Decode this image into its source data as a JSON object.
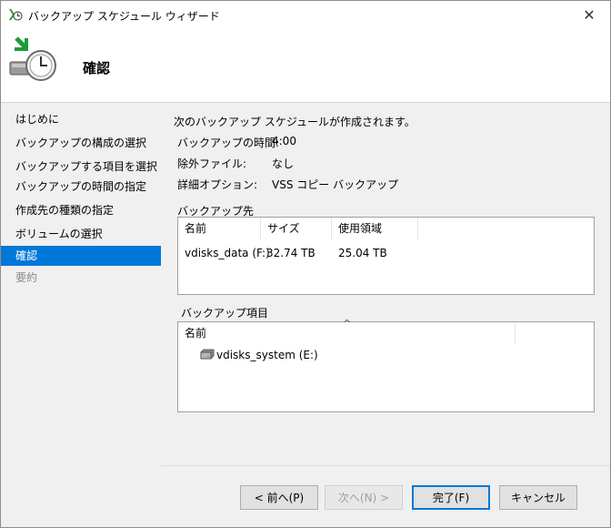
{
  "window": {
    "title": "バックアップ スケジュール ウィザード",
    "close_glyph": "✕"
  },
  "header": {
    "title": "確認"
  },
  "nav": {
    "items": [
      {
        "label": "はじめに",
        "state": "normal"
      },
      {
        "label": "バックアップの構成の選択",
        "state": "normal"
      },
      {
        "label": "バックアップする項目を選択",
        "state": "normal"
      },
      {
        "label": "バックアップの時間の指定",
        "state": "normal"
      },
      {
        "label": "作成先の種類の指定",
        "state": "normal"
      },
      {
        "label": "ボリュームの選択",
        "state": "normal"
      },
      {
        "label": "確認",
        "state": "selected"
      },
      {
        "label": "要約",
        "state": "disabled"
      }
    ]
  },
  "main": {
    "intro": "次のバックアップ スケジュールが作成されます。",
    "summary": [
      {
        "label": "バックアップの時間:",
        "value": "4:00"
      },
      {
        "label": "除外ファイル:",
        "value": "なし"
      },
      {
        "label": "詳細オプション:",
        "value": "VSS コピー バックアップ"
      }
    ],
    "destination": {
      "heading": "バックアップ先",
      "columns": [
        "名前",
        "サイズ",
        "使用領域"
      ],
      "rows": [
        {
          "name": "vdisks_data (F:)",
          "size": "32.74 TB",
          "used": "25.04 TB"
        }
      ]
    },
    "items": {
      "heading": "バックアップ項目",
      "column": "名前",
      "sort_glyph": "^",
      "rows": [
        {
          "name": "vdisks_system (E:)",
          "icon": "drive-icon"
        }
      ]
    }
  },
  "buttons": {
    "back": "< 前へ(P)",
    "next": "次へ(N) >",
    "finish": "完了(F)",
    "cancel": "キャンセル"
  },
  "colors": {
    "accent": "#0078d7",
    "panel": "#f0f0f0"
  }
}
